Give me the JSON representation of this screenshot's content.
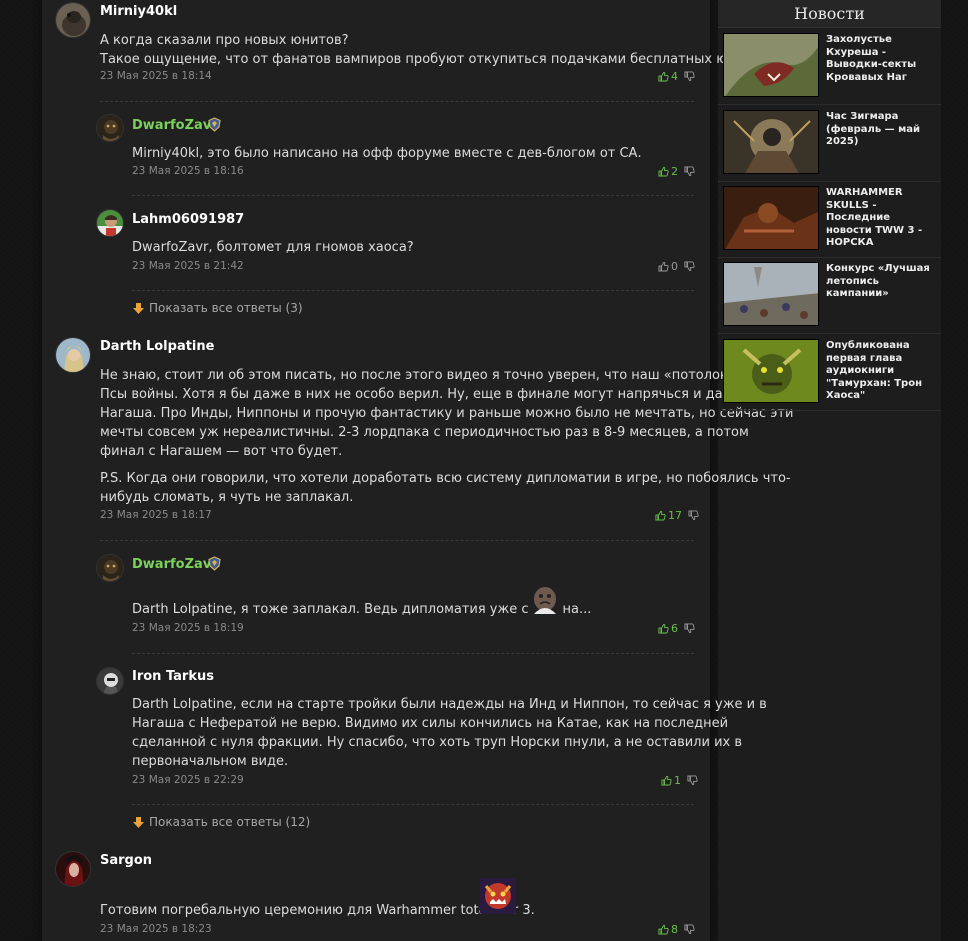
{
  "comments": [
    {
      "author": "Mirniy40kl",
      "text_lines": [
        "А когда сказали про новых юнитов?",
        "Такое ощущение, что от фанатов вампиров пробуют откупиться подачками бесплатных юнитов..."
      ],
      "date": "23 Мая 2025 в 18:14",
      "likes": "4"
    },
    {
      "author": "DwarfoZavr",
      "text": "Mirniy40kl, это было написано на офф форуме вместе с дев-блогом от СА.",
      "date": "23 Мая 2025 в 18:16",
      "likes": "2"
    },
    {
      "author": "Lahm06091987",
      "text": "DwarfoZavr, болтомет для гномов хаоса?",
      "date": "23 Мая 2025 в 21:42",
      "likes": "0"
    },
    {
      "author": "Darth Lolpatine",
      "paragraph1": [
        "Не знаю, стоит ли об этом писать, но после этого видео я точно уверен, что наш «потолок» — это",
        "Псы войны. Хотя я бы даже в них не особо верил. Ну, еще в финале могут напрячься и дать",
        "Нагаша. Про Инды, Ниппоны и прочую фантастику и раньше можно было не мечтать, но сейчас эти",
        "мечты совсем уж нереалистичны. 2-3 лордпака с периодичностью раз в 8-9 месяцев, а потом",
        "финал с Нагашем — вот что будет."
      ],
      "paragraph2": [
        "P.S. Когда они говорили, что хотели доработать всю систему дипломатии в игре, но побоялись что-",
        "нибудь сломать, я чуть не заплакал."
      ],
      "date": "23 Мая 2025 в 18:17",
      "likes": "17"
    },
    {
      "author": "DwarfoZavr",
      "text": "Darth Lolpatine, я тоже заплакал. Ведь дипломатия уже сломана...",
      "date": "23 Мая 2025 в 18:19",
      "likes": "6"
    },
    {
      "author": "Iron Tarkus",
      "text_lines": [
        "Darth Lolpatine, если на старте тройки были надежды на Инд и Ниппон, то сейчас я уже и в",
        "Нагаша с Нефератой не верю. Видимо их силы кончились на Катае, как на последней",
        "сделанной с нуля фракции. Ну спасибо, что хоть труп Норски пнули, а не оставили их в",
        "первоначальном виде."
      ],
      "date": "23 Мая 2025 в 22:29",
      "likes": "1"
    },
    {
      "author": "Sargon",
      "text": "Готовим погребальную церемонию для Warhammer total war 3.",
      "date": "23 Мая 2025 в 18:23",
      "likes": "8"
    }
  ],
  "show_more": [
    "Показать все ответы (3)",
    "Показать все ответы (12)"
  ],
  "sidebar": {
    "title": "Новости",
    "news": [
      {
        "title": "Захолустье Кхуреша - Выводки-секты Кровавых Наг"
      },
      {
        "title": "Час Зигмара (февраль — май 2025)"
      },
      {
        "title": "WARHAMMER SKULLS - Последние новости TWW 3 - НОРСКА"
      },
      {
        "title": "Конкурс «Лучшая летопись кампании»"
      },
      {
        "title": "Опубликована первая глава аудиокниги \"Тамурхан: Трон Хаоса\""
      }
    ]
  },
  "colors": {
    "accent_green": "#66c04a",
    "author_green": "#7bd15a",
    "panel_bg": "#202020",
    "page_bg": "#121212"
  },
  "icons": {
    "like": "thumbs-up-icon",
    "dislike": "thumbs-down-icon",
    "show_more": "arrow-down-icon",
    "rank": "shield-badge-icon"
  }
}
